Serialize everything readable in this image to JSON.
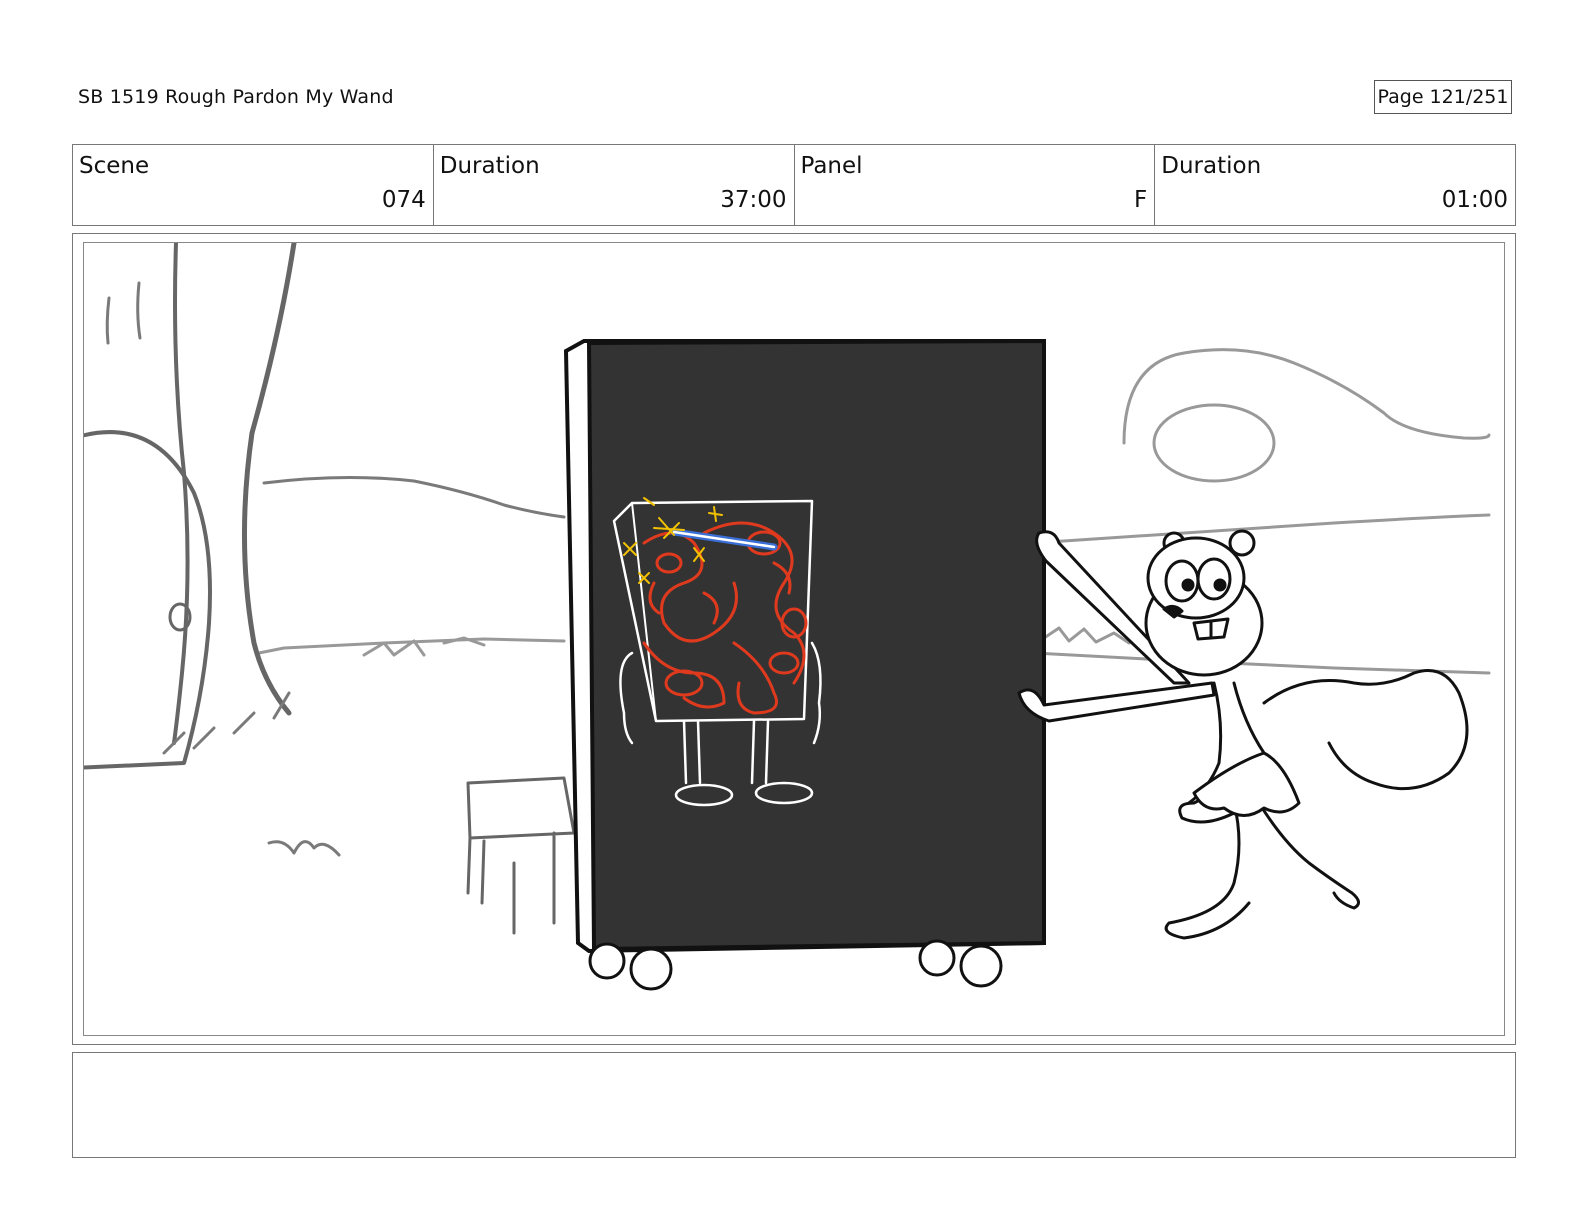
{
  "header": {
    "title": "SB 1519 Rough  Pardon My Wand",
    "page": "Page 121/251"
  },
  "info": {
    "scene_label": "Scene",
    "scene_value": "074",
    "duration_label": "Duration",
    "duration_value": "37:00",
    "panel_label": "Panel",
    "panel_value": "F",
    "panel_duration_label": "Duration",
    "panel_duration_value": "01:00"
  },
  "panel_image": {
    "description_colors": {
      "board": "#333333",
      "sketch_line": "#7a7a7a",
      "brain": "#e03a1e",
      "wand": "#3a6fd8",
      "sparkle": "#f2c200"
    }
  },
  "notes": {
    "text": ""
  }
}
